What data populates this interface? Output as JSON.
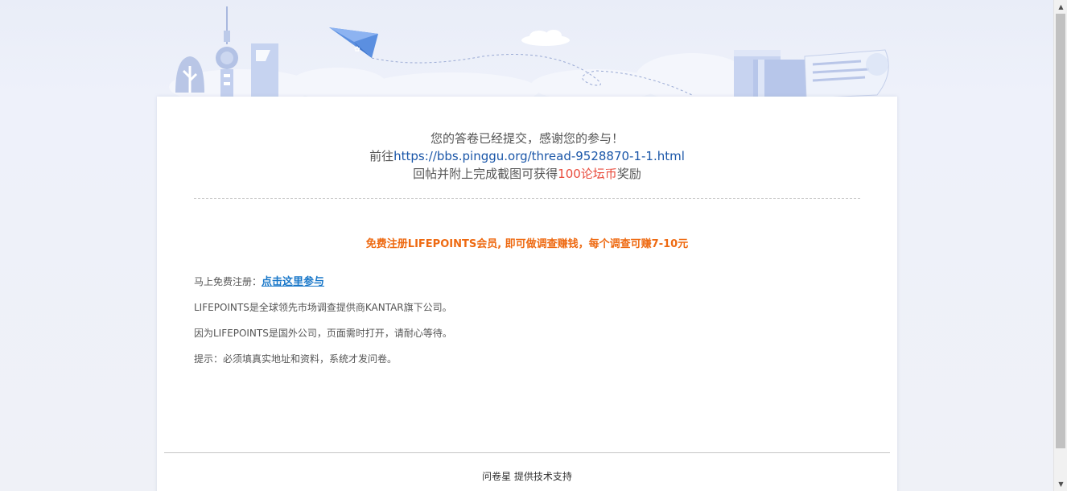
{
  "message": {
    "line1": "您的答卷已经提交，感谢您的参与！",
    "line2_prefix": "前往",
    "line2_link": "https://bbs.pinggu.org/thread-9528870-1-1.html",
    "line3_prefix": "回帖并附上完成截图可获得",
    "line3_highlight": "100论坛币",
    "line3_suffix": "奖励"
  },
  "promo": {
    "title": "免费注册LIFEPOINTS会员, 即可做调查赚钱，每个调查可赚7-10元"
  },
  "info": {
    "register_label": "马上免费注册：",
    "register_link": "点击这里参与",
    "line_company": "LIFEPOINTS是全球领先市场调查提供商KANTAR旗下公司。",
    "line_foreign": "因为LIFEPOINTS是国外公司，页面需时打开，请耐心等待。",
    "line_tip": "提示：必须填真实地址和资料，系统才发问卷。"
  },
  "footer": {
    "brand": "问卷星",
    "support": "提供技术支持"
  },
  "colors": {
    "link_blue": "#1a56a8",
    "highlight_red": "#e94b3c",
    "promo_orange": "#ee6a12",
    "register_link_blue": "#1a78c9"
  },
  "icons": {
    "scroll_up": "▲",
    "scroll_down": "▼"
  }
}
